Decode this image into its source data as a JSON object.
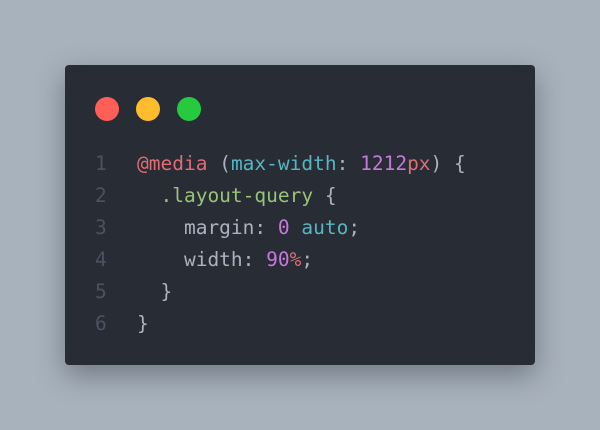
{
  "theme": {
    "background": "#a8b2bc",
    "editor_background": "#282c34",
    "traffic_lights": {
      "close": "#ff5f56",
      "minimize": "#ffbd2e",
      "maximize": "#27c93f"
    },
    "syntax": {
      "at_rule": "#e06c75",
      "property": "#56b6c2",
      "number": "#c678dd",
      "unit": "#e06c75",
      "selector": "#98c379",
      "keyword": "#56b6c2",
      "punctuation": "#abb2bf",
      "line_number": "#4b5263"
    }
  },
  "code": {
    "lines": [
      {
        "number": "1",
        "tokens": [
          {
            "text": "@media",
            "type": "at_rule"
          },
          {
            "text": " (",
            "type": "punctuation"
          },
          {
            "text": "max-width",
            "type": "property"
          },
          {
            "text": ": ",
            "type": "punctuation"
          },
          {
            "text": "1212",
            "type": "number"
          },
          {
            "text": "px",
            "type": "unit"
          },
          {
            "text": ") {",
            "type": "punctuation"
          }
        ]
      },
      {
        "number": "2",
        "tokens": [
          {
            "text": "  ",
            "type": "punctuation"
          },
          {
            "text": ".layout-query",
            "type": "selector"
          },
          {
            "text": " {",
            "type": "punctuation"
          }
        ]
      },
      {
        "number": "3",
        "tokens": [
          {
            "text": "    margin: ",
            "type": "punctuation"
          },
          {
            "text": "0",
            "type": "number"
          },
          {
            "text": " ",
            "type": "punctuation"
          },
          {
            "text": "auto",
            "type": "keyword"
          },
          {
            "text": ";",
            "type": "punctuation"
          }
        ]
      },
      {
        "number": "4",
        "tokens": [
          {
            "text": "    width: ",
            "type": "punctuation"
          },
          {
            "text": "90",
            "type": "number"
          },
          {
            "text": "%",
            "type": "unit"
          },
          {
            "text": ";",
            "type": "punctuation"
          }
        ]
      },
      {
        "number": "5",
        "tokens": [
          {
            "text": "  }",
            "type": "punctuation"
          }
        ]
      },
      {
        "number": "6",
        "tokens": [
          {
            "text": "}",
            "type": "punctuation"
          }
        ]
      }
    ]
  }
}
